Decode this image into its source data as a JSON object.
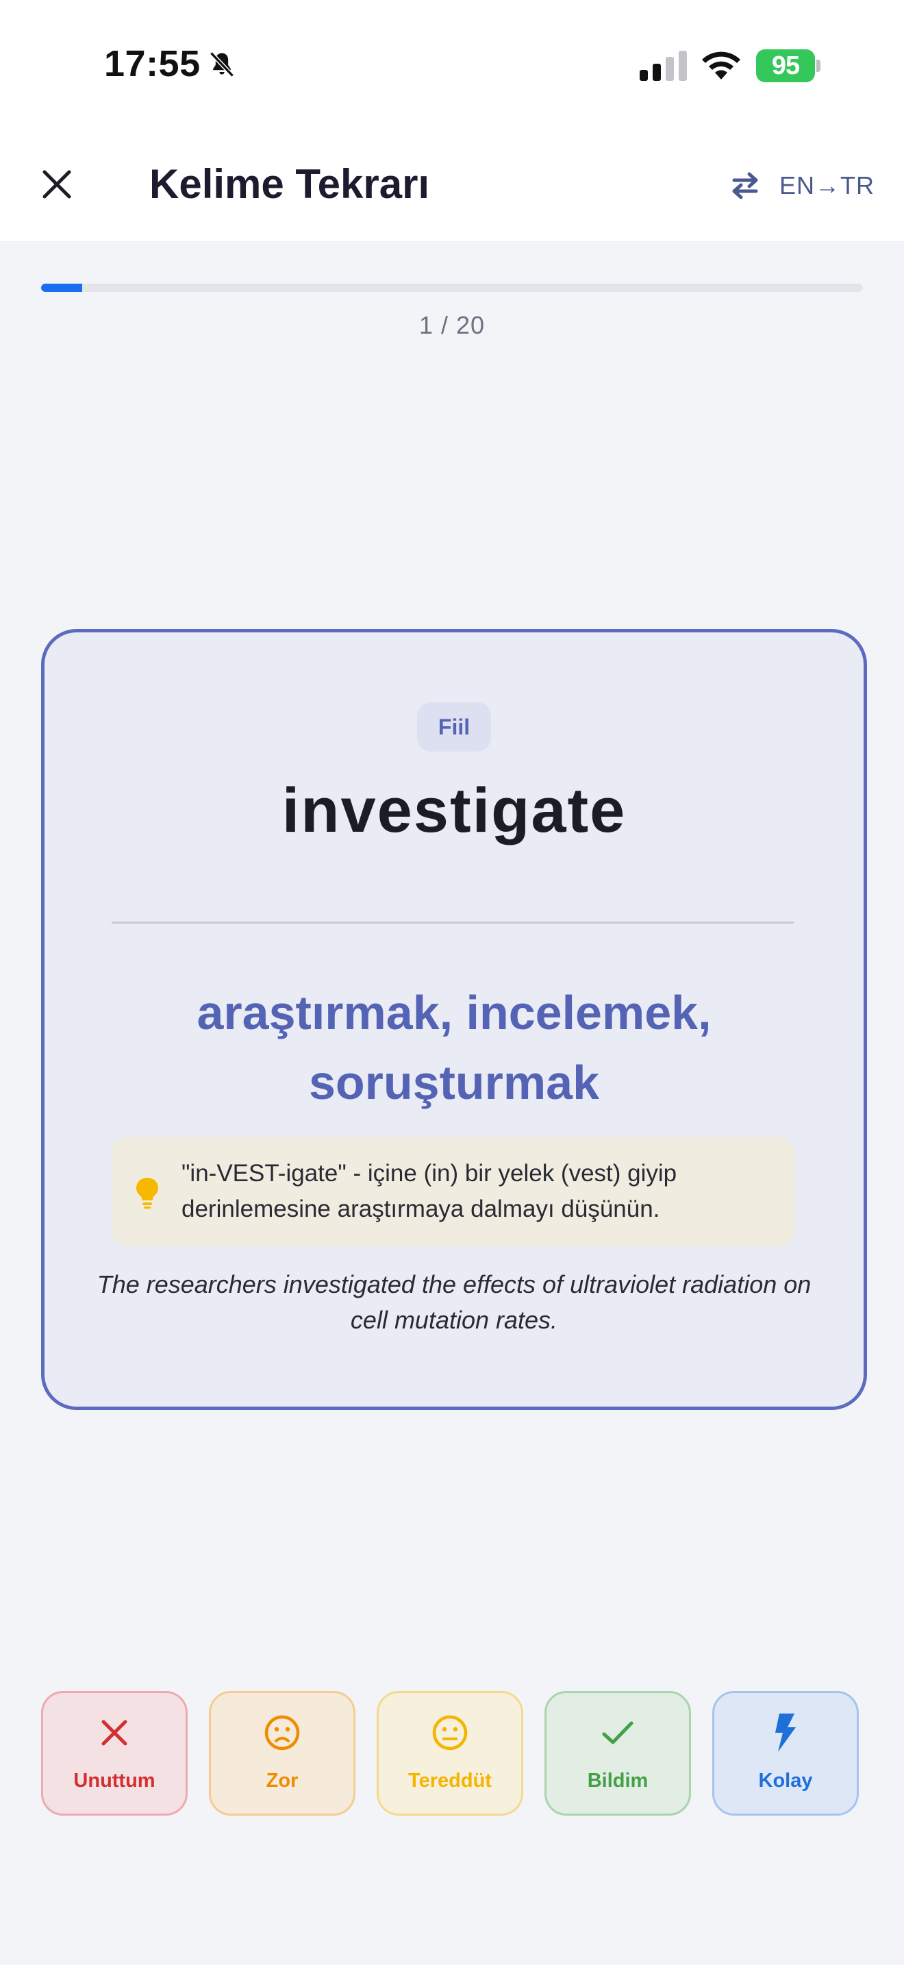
{
  "status_bar": {
    "time": "17:55",
    "battery": "95"
  },
  "header": {
    "title": "Kelime Tekrarı",
    "direction_label": "EN→TR"
  },
  "progress": {
    "text": "1 / 20",
    "current": 1,
    "total": 20,
    "fraction": 0.05,
    "color": "#1a6ff0"
  },
  "card": {
    "part_of_speech": "Fiil",
    "word": "investigate",
    "meaning": "araştırmak, incelemek, soruşturmak",
    "hint": "\"in-VEST-igate\" - içine (in) bir yelek (vest) giyip derinlemesine araştırmaya dalmayı düşünün.",
    "example": "The researchers investigated the effects of ultraviolet radiation on cell mutation rates.",
    "border_color": "#5c6bc0"
  },
  "ratings": [
    {
      "label": "Unuttum",
      "icon": "x-icon",
      "color": "#d32f2f"
    },
    {
      "label": "Zor",
      "icon": "frown-face-icon",
      "color": "#ef8c00"
    },
    {
      "label": "Tereddüt",
      "icon": "neutral-face-icon",
      "color": "#f4b400"
    },
    {
      "label": "Bildim",
      "icon": "check-icon",
      "color": "#43a047"
    },
    {
      "label": "Kolay",
      "icon": "lightning-icon",
      "color": "#1e6fd9"
    }
  ]
}
